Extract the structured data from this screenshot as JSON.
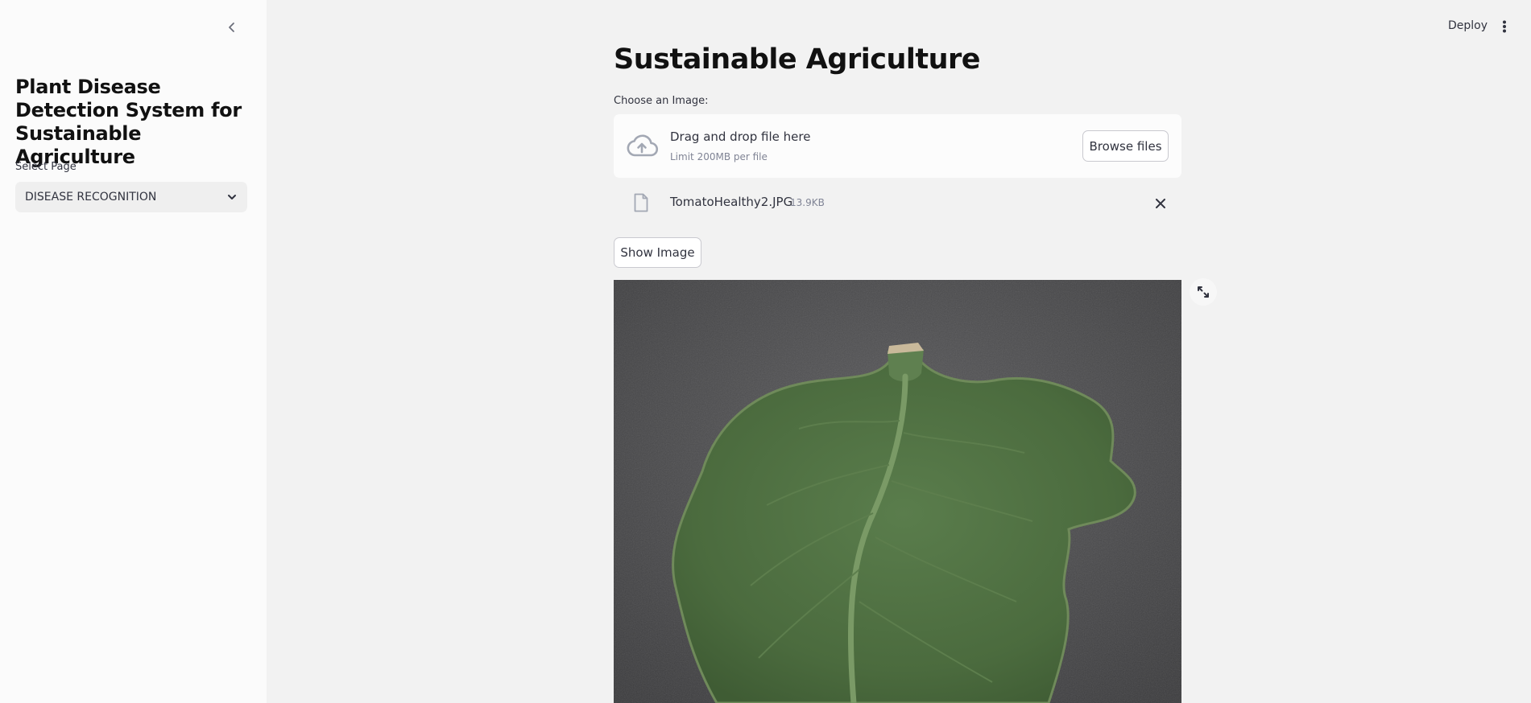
{
  "sidebar": {
    "title": "Plant Disease Detection System for Sustainable Agriculture",
    "select_label": "Select Page",
    "select_value": "DISEASE RECOGNITION",
    "collapse_icon": "chevron-left-icon"
  },
  "header": {
    "deploy_label": "Deploy",
    "menu_icon": "kebab-menu-icon"
  },
  "main": {
    "title": "Sustainable Agriculture",
    "uploader": {
      "label": "Choose an Image:",
      "drop_text": "Drag and drop file here",
      "limit_text": "Limit 200MB per file",
      "browse_label": "Browse files",
      "icon": "cloud-upload-icon"
    },
    "file": {
      "name": "TomatoHealthy2.JPG",
      "size": "13.9KB",
      "icon": "file-icon",
      "remove_icon": "close-icon"
    },
    "show_image_label": "Show Image",
    "expand_icon": "fullscreen-icon"
  },
  "colors": {
    "app_background": "#f2f2f2",
    "sidebar_background": "#fbfbfb",
    "text": "#31333f",
    "muted_text": "#808495"
  }
}
